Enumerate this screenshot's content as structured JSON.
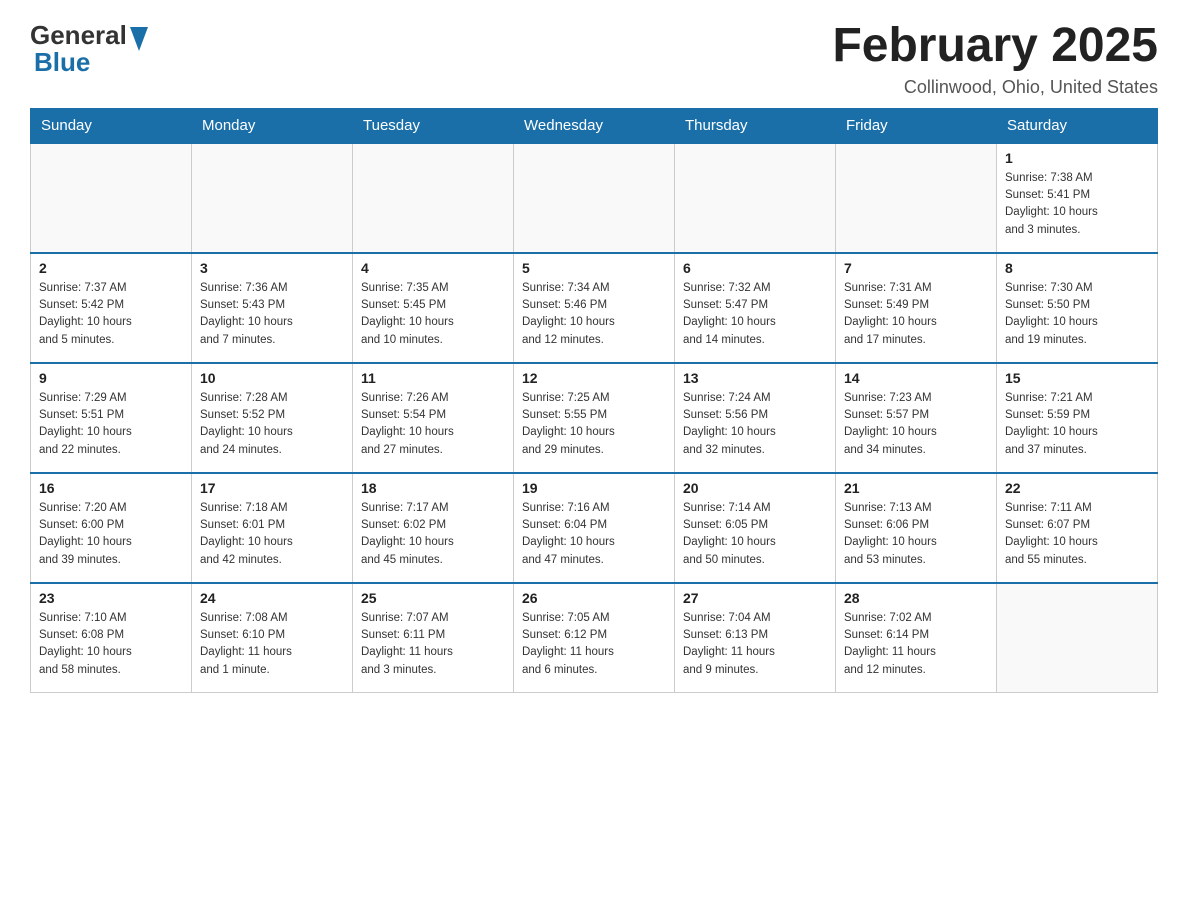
{
  "header": {
    "logo_general": "General",
    "logo_blue": "Blue",
    "title": "February 2025",
    "subtitle": "Collinwood, Ohio, United States"
  },
  "days_of_week": [
    "Sunday",
    "Monday",
    "Tuesday",
    "Wednesday",
    "Thursday",
    "Friday",
    "Saturday"
  ],
  "weeks": [
    [
      {
        "day": "",
        "info": ""
      },
      {
        "day": "",
        "info": ""
      },
      {
        "day": "",
        "info": ""
      },
      {
        "day": "",
        "info": ""
      },
      {
        "day": "",
        "info": ""
      },
      {
        "day": "",
        "info": ""
      },
      {
        "day": "1",
        "info": "Sunrise: 7:38 AM\nSunset: 5:41 PM\nDaylight: 10 hours\nand 3 minutes."
      }
    ],
    [
      {
        "day": "2",
        "info": "Sunrise: 7:37 AM\nSunset: 5:42 PM\nDaylight: 10 hours\nand 5 minutes."
      },
      {
        "day": "3",
        "info": "Sunrise: 7:36 AM\nSunset: 5:43 PM\nDaylight: 10 hours\nand 7 minutes."
      },
      {
        "day": "4",
        "info": "Sunrise: 7:35 AM\nSunset: 5:45 PM\nDaylight: 10 hours\nand 10 minutes."
      },
      {
        "day": "5",
        "info": "Sunrise: 7:34 AM\nSunset: 5:46 PM\nDaylight: 10 hours\nand 12 minutes."
      },
      {
        "day": "6",
        "info": "Sunrise: 7:32 AM\nSunset: 5:47 PM\nDaylight: 10 hours\nand 14 minutes."
      },
      {
        "day": "7",
        "info": "Sunrise: 7:31 AM\nSunset: 5:49 PM\nDaylight: 10 hours\nand 17 minutes."
      },
      {
        "day": "8",
        "info": "Sunrise: 7:30 AM\nSunset: 5:50 PM\nDaylight: 10 hours\nand 19 minutes."
      }
    ],
    [
      {
        "day": "9",
        "info": "Sunrise: 7:29 AM\nSunset: 5:51 PM\nDaylight: 10 hours\nand 22 minutes."
      },
      {
        "day": "10",
        "info": "Sunrise: 7:28 AM\nSunset: 5:52 PM\nDaylight: 10 hours\nand 24 minutes."
      },
      {
        "day": "11",
        "info": "Sunrise: 7:26 AM\nSunset: 5:54 PM\nDaylight: 10 hours\nand 27 minutes."
      },
      {
        "day": "12",
        "info": "Sunrise: 7:25 AM\nSunset: 5:55 PM\nDaylight: 10 hours\nand 29 minutes."
      },
      {
        "day": "13",
        "info": "Sunrise: 7:24 AM\nSunset: 5:56 PM\nDaylight: 10 hours\nand 32 minutes."
      },
      {
        "day": "14",
        "info": "Sunrise: 7:23 AM\nSunset: 5:57 PM\nDaylight: 10 hours\nand 34 minutes."
      },
      {
        "day": "15",
        "info": "Sunrise: 7:21 AM\nSunset: 5:59 PM\nDaylight: 10 hours\nand 37 minutes."
      }
    ],
    [
      {
        "day": "16",
        "info": "Sunrise: 7:20 AM\nSunset: 6:00 PM\nDaylight: 10 hours\nand 39 minutes."
      },
      {
        "day": "17",
        "info": "Sunrise: 7:18 AM\nSunset: 6:01 PM\nDaylight: 10 hours\nand 42 minutes."
      },
      {
        "day": "18",
        "info": "Sunrise: 7:17 AM\nSunset: 6:02 PM\nDaylight: 10 hours\nand 45 minutes."
      },
      {
        "day": "19",
        "info": "Sunrise: 7:16 AM\nSunset: 6:04 PM\nDaylight: 10 hours\nand 47 minutes."
      },
      {
        "day": "20",
        "info": "Sunrise: 7:14 AM\nSunset: 6:05 PM\nDaylight: 10 hours\nand 50 minutes."
      },
      {
        "day": "21",
        "info": "Sunrise: 7:13 AM\nSunset: 6:06 PM\nDaylight: 10 hours\nand 53 minutes."
      },
      {
        "day": "22",
        "info": "Sunrise: 7:11 AM\nSunset: 6:07 PM\nDaylight: 10 hours\nand 55 minutes."
      }
    ],
    [
      {
        "day": "23",
        "info": "Sunrise: 7:10 AM\nSunset: 6:08 PM\nDaylight: 10 hours\nand 58 minutes."
      },
      {
        "day": "24",
        "info": "Sunrise: 7:08 AM\nSunset: 6:10 PM\nDaylight: 11 hours\nand 1 minute."
      },
      {
        "day": "25",
        "info": "Sunrise: 7:07 AM\nSunset: 6:11 PM\nDaylight: 11 hours\nand 3 minutes."
      },
      {
        "day": "26",
        "info": "Sunrise: 7:05 AM\nSunset: 6:12 PM\nDaylight: 11 hours\nand 6 minutes."
      },
      {
        "day": "27",
        "info": "Sunrise: 7:04 AM\nSunset: 6:13 PM\nDaylight: 11 hours\nand 9 minutes."
      },
      {
        "day": "28",
        "info": "Sunrise: 7:02 AM\nSunset: 6:14 PM\nDaylight: 11 hours\nand 12 minutes."
      },
      {
        "day": "",
        "info": ""
      }
    ]
  ]
}
